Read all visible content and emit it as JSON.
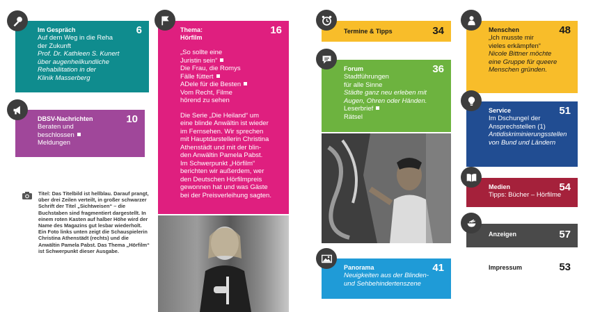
{
  "colors": {
    "teal": "#0f8c8e",
    "purple": "#a0479a",
    "magenta": "#df1f7f",
    "yellow": "#f8bd2a",
    "green": "#6db33f",
    "dark_red": "#a5213b",
    "blue": "#1f9bd7",
    "navy": "#214d92",
    "charcoal": "#4a4a4a",
    "badge": "#3d3d3d"
  },
  "sections": {
    "im_gespraech": {
      "icon": "microphone-icon",
      "title": "Im Gespräch",
      "page": "6",
      "lines": [
        "Auf dem Weg in die Reha",
        "der Zukunft"
      ],
      "italic": [
        "Prof. Dr. Kathleen S. Kunert",
        "über augenheilkundliche",
        "Rehabilitation in der",
        "Klinik Masserberg"
      ]
    },
    "dbsv": {
      "icon": "megaphone-icon",
      "title": "DBSV-Nachrichten",
      "page": "10",
      "lines": [
        "Beraten und",
        "beschlossen",
        "Meldungen"
      ]
    },
    "thema": {
      "icon": "flag-icon",
      "title": "Thema:",
      "title2": "Hörfilm",
      "page": "16",
      "lines": [
        "„So sollte eine",
        "Juristin sein“",
        "Die Frau, die Romys",
        "Fälle füttert",
        "ADele für die Besten",
        "Vom Recht, Filme",
        "hörend zu sehen"
      ],
      "paragraph": [
        "Die Serie „Die Heiland“ um",
        "eine blinde Anwältin ist wieder",
        "im Fernsehen. Wir sprechen",
        "mit Hauptdarstellerin Christina",
        "Athenstädt und mit der blin-",
        "den Anwältin Pamela Pabst.",
        "Im Schwerpunkt „Hörfilm“",
        "berichten wir außerdem, wer",
        "den Deutschen Hörfilmpreis",
        "gewonnen hat und was Gäste",
        "bei der Preisverleihung sagten."
      ]
    },
    "termine": {
      "icon": "alarm-clock-icon",
      "title": "Termine & Tipps",
      "page": "34"
    },
    "forum": {
      "icon": "speech-bubble-icon",
      "title": "Forum",
      "page": "36",
      "lines": [
        "Stadtführungen",
        "für alle Sinne"
      ],
      "italic": [
        "Städte ganz neu erleben mit",
        "Augen, Ohren oder Händen."
      ],
      "lines2": [
        "Leserbrief",
        "Rätsel"
      ]
    },
    "panorama": {
      "icon": "picture-icon",
      "title": "Panorama",
      "page": "41",
      "italic": [
        "Neuigkeiten aus der Blinden-",
        "und Sehbehindertenszene"
      ]
    },
    "menschen": {
      "icon": "person-icon",
      "title": "Menschen",
      "page": "48",
      "lines": [
        "„Ich musste mir",
        "vieles erkämpfen“"
      ],
      "italic": [
        "Nicole Bittner möchte",
        "eine Gruppe für queere",
        "Menschen gründen."
      ]
    },
    "service": {
      "icon": "lightbulb-icon",
      "title": "Service",
      "page": "51",
      "lines": [
        "Im Dschungel der",
        "Ansprechstellen (1)"
      ],
      "italic": [
        "Antidiskriminierungsstellen",
        "von Bund und Ländern"
      ]
    },
    "medien": {
      "icon": "book-icon",
      "title": "Medien",
      "page": "54",
      "lines": [
        "Tipps: Bücher – Hörfilme"
      ]
    },
    "anzeigen": {
      "icon": "bowl-icon",
      "title": "Anzeigen",
      "page": "57"
    },
    "impressum": {
      "title": "Impressum",
      "page": "53"
    }
  },
  "caption": {
    "icon": "camera-icon",
    "text": "Titel: Das Titelbild ist hellblau. Darauf prangt, über drei Zeilen verteilt, in großer schwarzer Schrift der Titel „Sichtweisen“ – die Buchstaben sind fragmentiert dargestellt. In einem roten Kasten auf halber Höhe wird der Name des Magazins gut lesbar wiederholt. Ein Foto links unten zeigt die Schauspielerin Christina Athenstädt (rechts) und die Anwältin Pamela Pabst. Das Thema „Hörfilm“ ist Schwerpunkt dieser Ausgabe."
  }
}
